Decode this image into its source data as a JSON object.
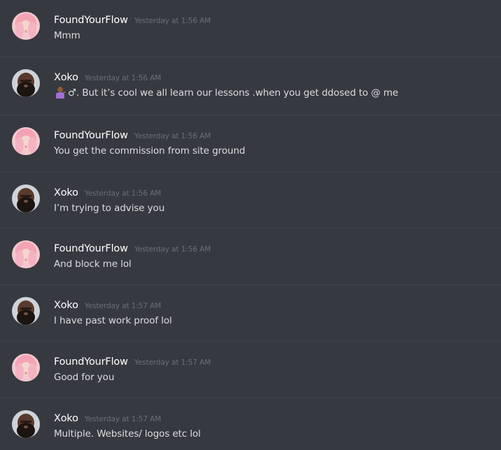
{
  "messages": [
    {
      "author": "FoundYourFlow",
      "avatar": "pink-hair-avatar",
      "timestamp": "Yesterday at 1:56 AM",
      "text": "Mmm"
    },
    {
      "author": "Xoko",
      "avatar": "bearded-man-avatar",
      "timestamp": "Yesterday at 1:56 AM",
      "emoji": "man-tipping-hand-emoji",
      "text": "♂. But it’s cool we all learn our lessons .when you get ddosed to @ me"
    },
    {
      "author": "FoundYourFlow",
      "avatar": "pink-hair-avatar",
      "timestamp": "Yesterday at 1:56 AM",
      "text": "You get the commission from site ground"
    },
    {
      "author": "Xoko",
      "avatar": "bearded-man-avatar",
      "timestamp": "Yesterday at 1:56 AM",
      "text": "I’m trying to advise you"
    },
    {
      "author": "FoundYourFlow",
      "avatar": "pink-hair-avatar",
      "timestamp": "Yesterday at 1:56 AM",
      "text": "And block me lol"
    },
    {
      "author": "Xoko",
      "avatar": "bearded-man-avatar",
      "timestamp": "Yesterday at 1:57 AM",
      "text": "I have past work proof lol"
    },
    {
      "author": "FoundYourFlow",
      "avatar": "pink-hair-avatar",
      "timestamp": "Yesterday at 1:57 AM",
      "text": "Good for you"
    },
    {
      "author": "Xoko",
      "avatar": "bearded-man-avatar",
      "timestamp": "Yesterday at 1:57 AM",
      "text": "Multiple. Websites/ logos etc lol"
    }
  ]
}
